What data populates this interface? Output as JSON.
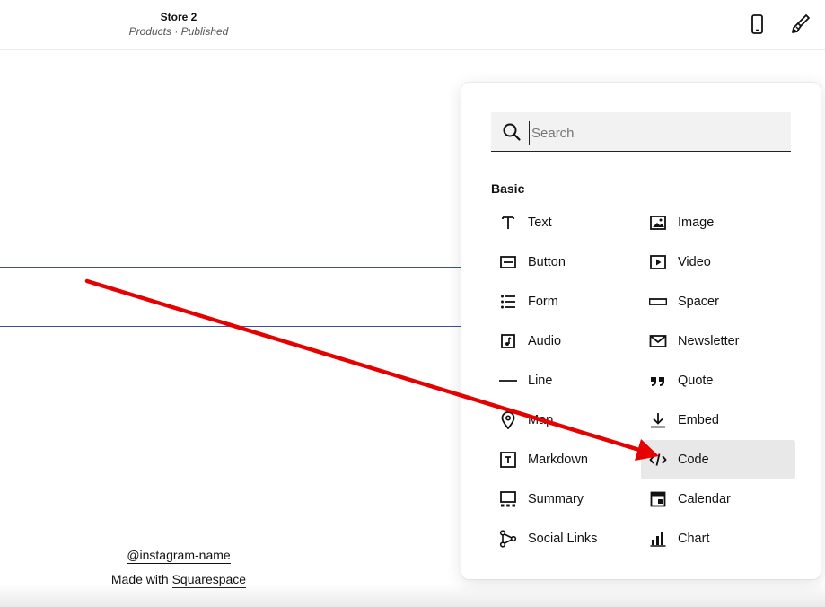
{
  "header": {
    "site_title": "Store 2",
    "site_status": "Products · Published",
    "mobile_icon": "mobile-phone-icon",
    "design_icon": "paintbrush-icon"
  },
  "footer": {
    "instagram": "@instagram-name",
    "made_with_prefix": "Made with ",
    "made_with_link": "Squarespace"
  },
  "panel": {
    "search_placeholder": "Search",
    "section_label": "Basic",
    "items_left": [
      {
        "label": "Text",
        "icon": "text-icon"
      },
      {
        "label": "Button",
        "icon": "button-icon"
      },
      {
        "label": "Form",
        "icon": "form-icon"
      },
      {
        "label": "Audio",
        "icon": "audio-icon"
      },
      {
        "label": "Line",
        "icon": "line-icon"
      },
      {
        "label": "Map",
        "icon": "map-pin-icon"
      },
      {
        "label": "Markdown",
        "icon": "markdown-icon"
      },
      {
        "label": "Summary",
        "icon": "summary-icon"
      },
      {
        "label": "Social Links",
        "icon": "social-links-icon"
      }
    ],
    "items_right": [
      {
        "label": "Image",
        "icon": "image-icon"
      },
      {
        "label": "Video",
        "icon": "video-icon"
      },
      {
        "label": "Spacer",
        "icon": "spacer-icon"
      },
      {
        "label": "Newsletter",
        "icon": "newsletter-icon"
      },
      {
        "label": "Quote",
        "icon": "quote-icon"
      },
      {
        "label": "Embed",
        "icon": "embed-icon"
      },
      {
        "label": "Code",
        "icon": "code-icon",
        "selected": true
      },
      {
        "label": "Calendar",
        "icon": "calendar-icon"
      },
      {
        "label": "Chart",
        "icon": "chart-icon"
      }
    ]
  },
  "colors": {
    "accent_line": "#3c4f9c",
    "annotation_arrow": "#e60000",
    "selected_bg": "#e8e8e8"
  }
}
